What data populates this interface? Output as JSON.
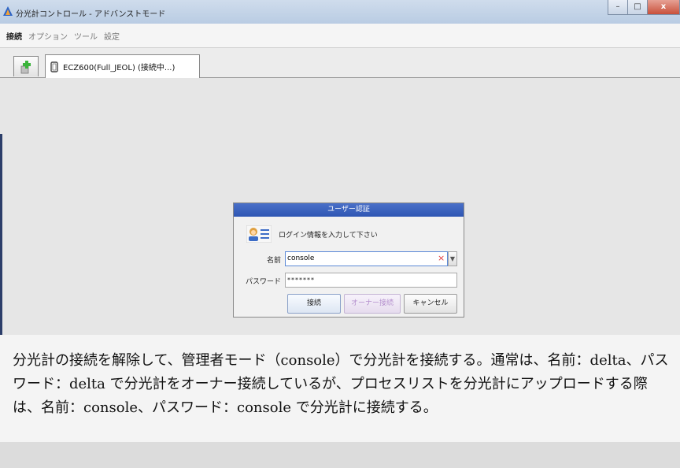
{
  "window": {
    "title": "分光計コントロール - アドバンストモード",
    "controls": {
      "minimize": "–",
      "maximize": "□",
      "close": "x"
    }
  },
  "menu": {
    "items": [
      "接続",
      "オプション",
      "ツール",
      "設定"
    ]
  },
  "tabs": {
    "add_tab_icon": "plus-icon",
    "active_label": "ECZ600(Full_JEOL) (接続中...)"
  },
  "dialog": {
    "title": "ユーザー認証",
    "message": "ログイン情報を入力して下さい",
    "name_label": "名前",
    "name_value": "console",
    "password_label": "パスワード",
    "password_value": "*******",
    "buttons": {
      "connect": "接続",
      "owner_connect": "オーナー接続",
      "cancel": "キャンセル"
    }
  },
  "caption": {
    "text": "分光計の接続を解除して、管理者モード（console）で分光計を接続する。通常は、名前：delta、パスワード：delta で分光計をオーナー接続しているが、プロセスリストを分光計にアップロードする際は、名前：console、パスワード：console で分光計に接続する。"
  },
  "colors": {
    "dialog_title_bar": "#2e56b3",
    "owner_button_text": "#b48fcd",
    "clear_x": "#e23a3a"
  }
}
